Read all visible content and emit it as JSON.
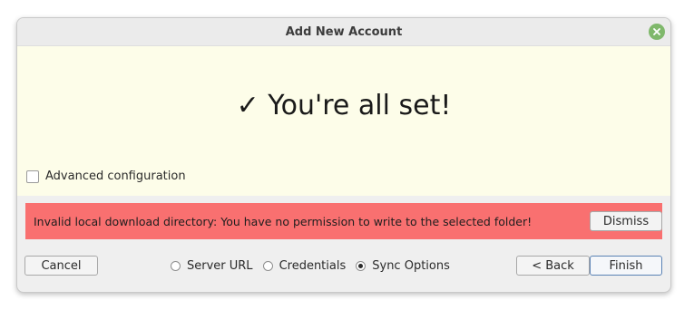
{
  "window": {
    "title": "Add New Account"
  },
  "icons": {
    "close": "close-icon",
    "check": "check-icon"
  },
  "colors": {
    "content_bg": "#fdfde9",
    "error_bg": "#f97070",
    "close_button": "#7fb86b",
    "finish_border": "#5a82b4"
  },
  "main": {
    "headline": "✓ You're all set!",
    "advanced_label": "Advanced configuration",
    "advanced_checked": false
  },
  "error": {
    "message": "Invalid local download directory: You have no permission to write to the selected folder!",
    "dismiss_label": "Dismiss"
  },
  "footer": {
    "cancel_label": "Cancel",
    "back_label": "< Back",
    "finish_label": "Finish",
    "steps": [
      {
        "label": "Server URL",
        "selected": false
      },
      {
        "label": "Credentials",
        "selected": false
      },
      {
        "label": "Sync Options",
        "selected": true
      }
    ]
  }
}
